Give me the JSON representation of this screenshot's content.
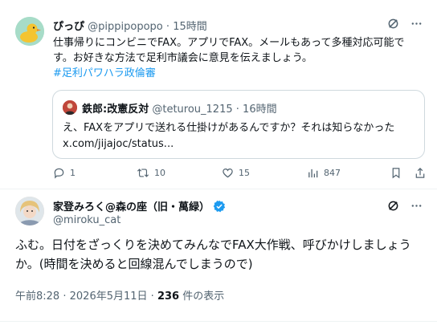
{
  "tweet1": {
    "display_name": "ぴっぴ",
    "handle": "@pippipopopo",
    "sep": "·",
    "time": "15時間",
    "text": "仕事帰りにコンビニでFAX。アプリでFAX。メールもあって多種対応可能です。お好きな方法で足利市議会に意見を伝えましょう。",
    "hashtag": "#足利パワハラ政倫審",
    "quote": {
      "display_name": "鉄郎:改憲反対",
      "handle": "@teturou_1215",
      "sep": "·",
      "time": "16時間",
      "line1": "え、FAXをアプリで送れる仕掛けがあるんですか？それは知らなかった",
      "line2": "x.com/jijajoc/status..."
    },
    "actions": {
      "replies": "1",
      "reposts": "10",
      "likes": "15",
      "views": "847"
    }
  },
  "tweet2": {
    "display_name": "家登みろく@森の座（旧・萬緑）",
    "handle": "@miroku_cat",
    "text": "ふむ。日付をざっくりを決めてみんなでFAX大作戦、呼びかけしましょうか。(時間を決めると回線混んでしまうので)",
    "time": "午前8:28",
    "sep": "·",
    "date": "2026年5月11日",
    "views_count": "236",
    "views_label": "件の表示"
  },
  "colors": {
    "text": "#0f1419",
    "secondary": "#536471",
    "link": "#1d9bf0",
    "verified": "#1d9bf0",
    "border": "#cfd9de"
  }
}
